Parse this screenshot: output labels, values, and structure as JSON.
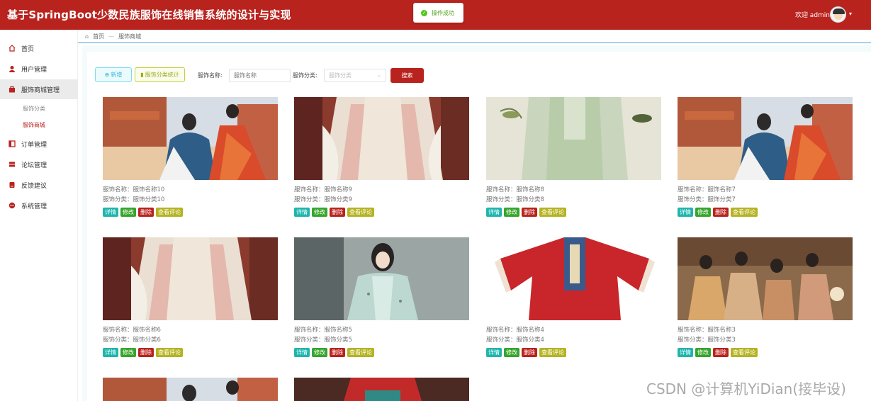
{
  "header": {
    "title": "基于SpringBoot少数民族服饰在线销售系统的设计与实现",
    "welcome": "欢迎 admin",
    "toast": "操作成功",
    "brand_color": "#b9231e"
  },
  "sidebar": {
    "items": [
      {
        "label": "首页",
        "icon": "home-icon"
      },
      {
        "label": "用户管理",
        "icon": "user-icon"
      },
      {
        "label": "服饰商城管理",
        "icon": "shop-icon",
        "active": true
      },
      {
        "label": "订单管理",
        "icon": "order-icon"
      },
      {
        "label": "论坛管理",
        "icon": "forum-icon"
      },
      {
        "label": "反馈建议",
        "icon": "feedback-icon"
      },
      {
        "label": "系统管理",
        "icon": "system-icon"
      }
    ],
    "sub_items": [
      {
        "label": "服饰分类"
      },
      {
        "label": "服饰商城",
        "active": true
      }
    ]
  },
  "breadcrumb": {
    "home": "首页",
    "separator": "—",
    "current": "服饰商城"
  },
  "toolbar": {
    "add_label": "新增",
    "stat_label": "服饰分类统计",
    "name_label": "服饰名称:",
    "name_placeholder": "服饰名称",
    "category_label": "服饰分类:",
    "category_placeholder": "服饰分类",
    "search_label": "搜索"
  },
  "actions": {
    "detail": "详情",
    "edit": "修改",
    "delete": "删除",
    "review": "查看评论"
  },
  "products": [
    {
      "name": "服饰名称：服饰名称10",
      "category": "服饰分类：服饰分类10"
    },
    {
      "name": "服饰名称：服饰名称9",
      "category": "服饰分类：服饰分类9"
    },
    {
      "name": "服饰名称：服饰名称8",
      "category": "服饰分类：服饰分类8"
    },
    {
      "name": "服饰名称：服饰名称7",
      "category": "服饰分类：服饰分类7"
    },
    {
      "name": "服饰名称：服饰名称6",
      "category": "服饰分类：服饰分类6"
    },
    {
      "name": "服饰名称：服饰名称5",
      "category": "服饰分类：服饰分类5"
    },
    {
      "name": "服饰名称：服饰名称4",
      "category": "服饰分类：服饰分类4"
    },
    {
      "name": "服饰名称：服饰名称3",
      "category": "服饰分类：服饰分类3"
    }
  ],
  "watermark": "CSDN @计算机YiDian(接毕设)"
}
